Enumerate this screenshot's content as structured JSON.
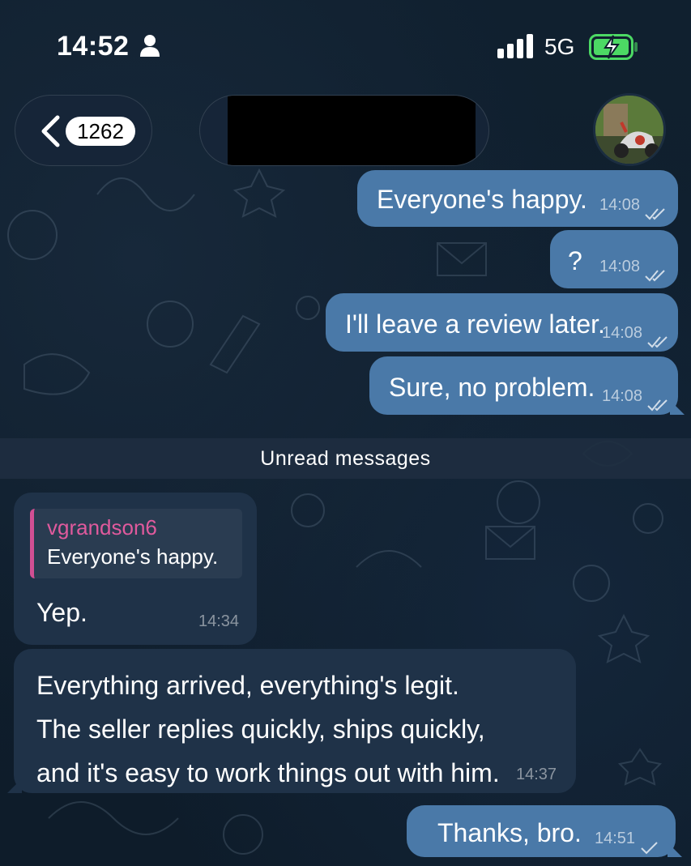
{
  "status_bar": {
    "time": "14:52",
    "network": "5G",
    "icons": [
      "person-icon",
      "signal-icon",
      "battery-charging-icon"
    ]
  },
  "header": {
    "back_badge": "1262",
    "chat_title": "",
    "icons": [
      "chevron-left-icon",
      "avatar"
    ]
  },
  "colors": {
    "outgoing_bubble": "#4a79a8",
    "incoming_bubble": "#1f3248",
    "reply_accent": "#d14f93",
    "battery_accent": "#4cd964"
  },
  "messages_before": [
    {
      "text": "Everyone's happy.",
      "time": "14:08",
      "status": "read"
    },
    {
      "text": "?",
      "time": "14:08",
      "status": "read"
    },
    {
      "text": "I'll leave a review later.",
      "time": "14:08",
      "status": "read"
    },
    {
      "text": "Sure, no problem.",
      "time": "14:08",
      "status": "read"
    }
  ],
  "unread_separator": "Unread messages",
  "incoming": [
    {
      "reply_to": {
        "name": "vgrandson6",
        "text": "Everyone's happy."
      },
      "text": "Yep.",
      "time": "14:34"
    },
    {
      "lines": [
        "Everything arrived, everything's legit.",
        "The seller replies quickly, ships quickly,",
        "and it's easy to work things out with him."
      ],
      "time": "14:37"
    }
  ],
  "last_outgoing": {
    "text": "Thanks, bro.",
    "time": "14:51",
    "status": "sent"
  }
}
